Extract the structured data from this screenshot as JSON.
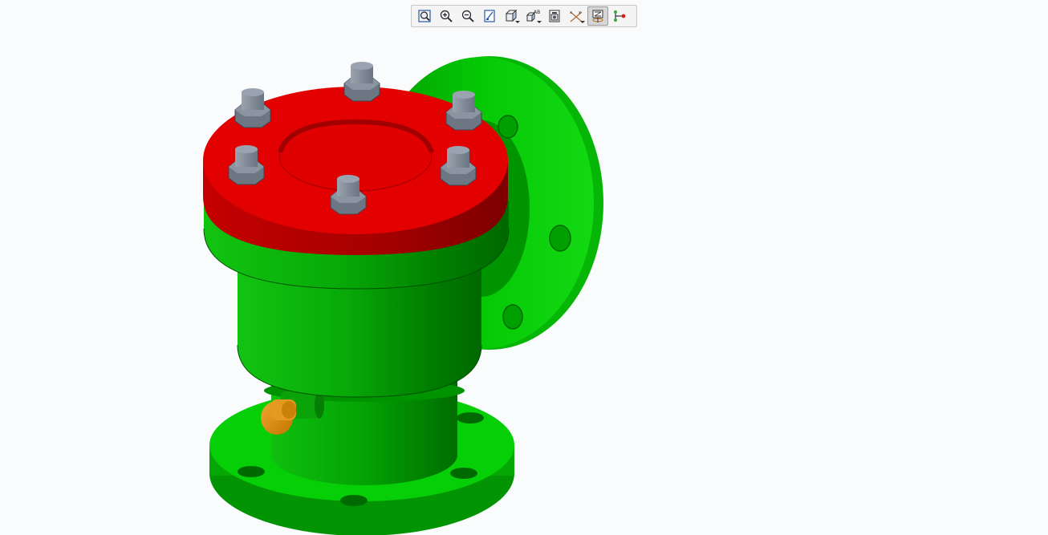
{
  "toolbar": {
    "buttons": [
      {
        "name": "refit-icon",
        "active": false
      },
      {
        "name": "zoom-in-icon",
        "active": false
      },
      {
        "name": "zoom-out-icon",
        "active": false
      },
      {
        "name": "repaint-icon",
        "active": false
      },
      {
        "name": "display-style-icon",
        "active": false,
        "dropdown": true
      },
      {
        "name": "saved-views-icon",
        "active": false,
        "dropdown": true
      },
      {
        "name": "view-manager-icon",
        "active": false
      },
      {
        "name": "datum-display-icon",
        "active": false,
        "dropdown": true
      },
      {
        "name": "spin-center-icon",
        "active": true
      },
      {
        "name": "annotation-display-icon",
        "active": false
      }
    ]
  },
  "model": {
    "description_colors": {
      "body": "#08c808",
      "body_shadow": "#007a00",
      "cap": "#e00000",
      "cap_shadow": "#9b0000",
      "bolt": "#7a8594",
      "plug": "#d98a10"
    }
  }
}
